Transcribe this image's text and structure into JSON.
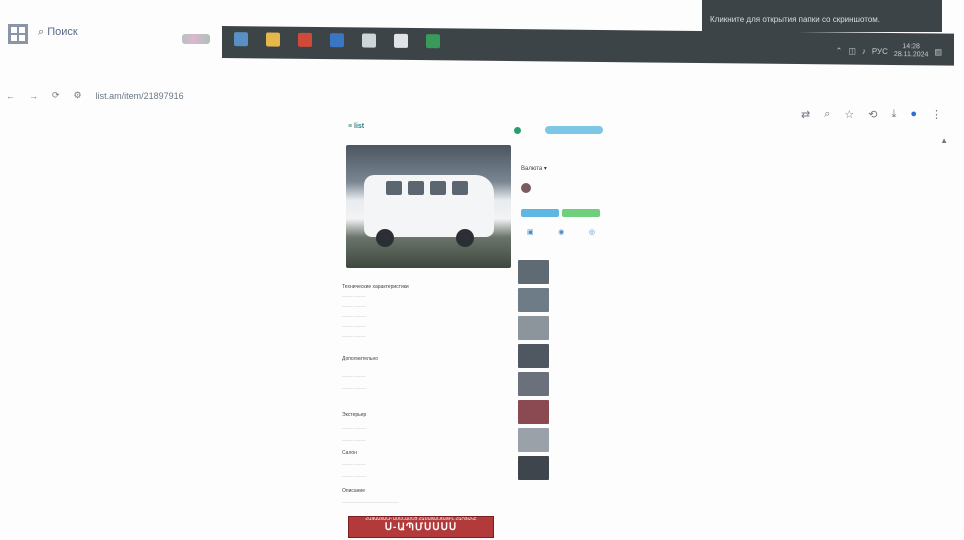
{
  "tooltip": {
    "text": "Кликните для открытия папки со скриншотом."
  },
  "taskbar": {
    "search_label": "Поиск",
    "apps": [
      {
        "name": "app-docs-icon",
        "color": "#5a8fc6"
      },
      {
        "name": "app-folder-icon",
        "color": "#e6b84a"
      },
      {
        "name": "app-chrome-icon",
        "color": "#d04a3a"
      },
      {
        "name": "app-word-icon",
        "color": "#3a76c4"
      },
      {
        "name": "app-explorer-icon",
        "color": "#cfd4d9"
      },
      {
        "name": "app-media-icon",
        "color": "#e0e4e8"
      },
      {
        "name": "app-excel-icon",
        "color": "#3a9a5a"
      }
    ],
    "tray": {
      "lang": "РУС",
      "time": "14:28",
      "date": "28.11.2024"
    }
  },
  "browser": {
    "url": "list.am/item/21897916",
    "back_icon": "←",
    "forward_icon": "→",
    "reload_icon": "⟳"
  },
  "listing": {
    "logo": "≡ list",
    "currency": "Валюта ▾",
    "actions": [
      "▣",
      "◉",
      "◎"
    ]
  },
  "similar_items": [
    {
      "thumb_color": "#5f6a74"
    },
    {
      "thumb_color": "#6e7c88"
    },
    {
      "thumb_color": "#8c949c"
    },
    {
      "thumb_color": "#4f5861"
    },
    {
      "thumb_color": "#6a717a"
    },
    {
      "thumb_color": "#8b4a52"
    },
    {
      "thumb_color": "#9aa1a8"
    },
    {
      "thumb_color": "#3e454c"
    }
  ],
  "sections": [
    "Технические характеристики",
    "Дополнительно",
    "Экстерьер",
    "Салон",
    "Описание"
  ],
  "banner": {
    "text": "Ս-ԱՊՄՍՍՍՍ",
    "small": "ՀԱՅԱՍՏԱՆԻ ԱՄԵՆԱՄԵԾ ՀԱՄԱՑԱՆՑԱՅԻՆ ՀԱՐԹԱԿԸ"
  }
}
